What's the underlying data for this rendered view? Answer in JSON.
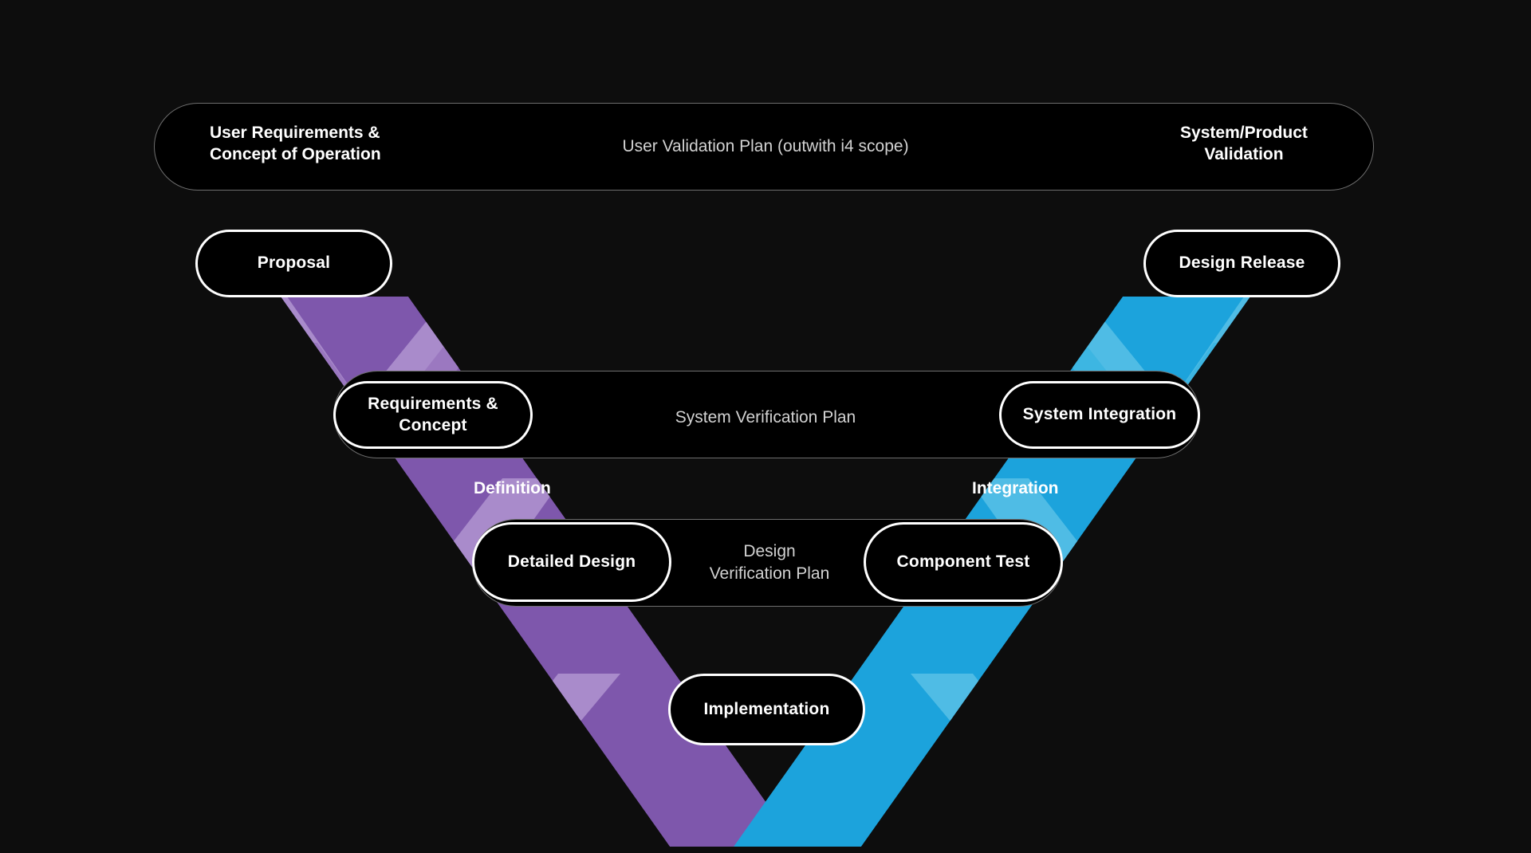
{
  "diagram": {
    "title": "V-Model Systems Engineering Lifecycle",
    "background_color": "#0d0d0d",
    "colors": {
      "purple_dark": "#7e57ac",
      "purple_light": "#a98bcb",
      "cyan_dark": "#1ca3dc",
      "cyan_light": "#4fbce5",
      "pill_border": "#ffffff",
      "pill_fill": "#000000",
      "bar_border": "#6e6e6e",
      "plan_text": "#d2d2d2"
    }
  },
  "top_bar": {
    "left_label": "User Requirements &\nConcept of Operation",
    "center_label": "User Validation Plan (outwith i4 scope)",
    "right_label": "System/Product\nValidation"
  },
  "level_1": {
    "left_pill": "Proposal",
    "right_pill": "Design Release"
  },
  "level_2": {
    "left_pill": "Requirements &\nConcept",
    "center_label": "System Verification Plan",
    "right_pill": "System Integration"
  },
  "level_3": {
    "left_pill": "Detailed Design",
    "center_label": "Design\nVerification Plan",
    "right_pill": "Component Test"
  },
  "level_4": {
    "bottom_pill": "Implementation"
  },
  "phases": {
    "left_caption": "Definition",
    "right_caption": "Integration"
  }
}
